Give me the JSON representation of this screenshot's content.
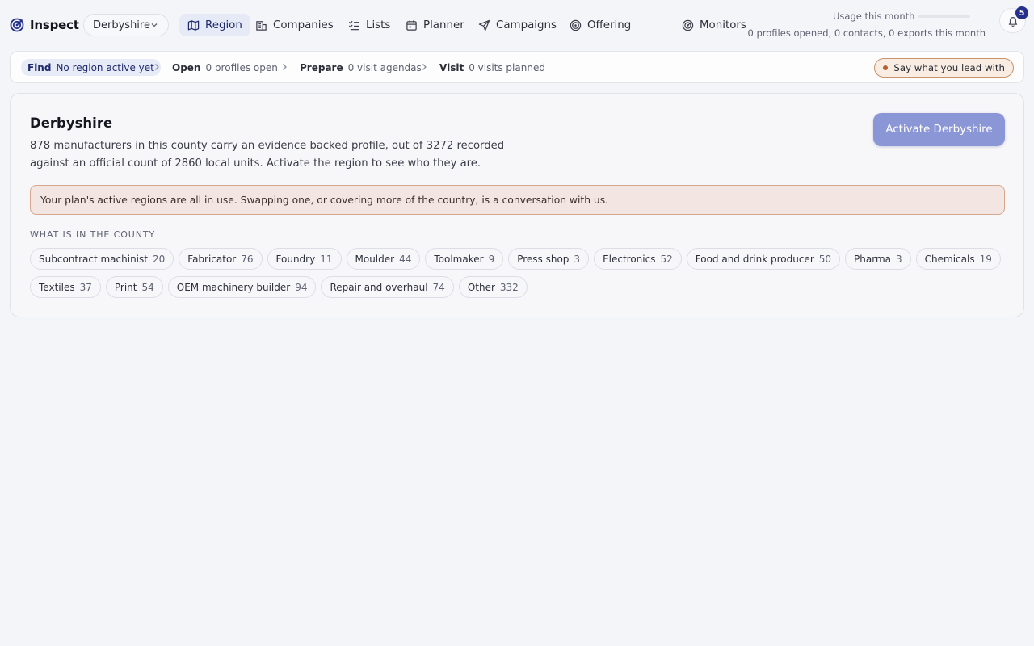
{
  "brand": {
    "name": "Inspect"
  },
  "region_select": {
    "value": "Derbyshire"
  },
  "nav": {
    "region": "Region",
    "companies": "Companies",
    "lists": "Lists",
    "planner": "Planner",
    "campaigns": "Campaigns",
    "offering": "Offering",
    "monitors": "Monitors"
  },
  "usage": {
    "label": "Usage this month",
    "progress": 0,
    "detail": "0 profiles opened, 0 contacts, 0 exports this month"
  },
  "notifications": {
    "count": "5"
  },
  "steps": {
    "find": {
      "name": "Find",
      "value": "No region active yet"
    },
    "open": {
      "name": "Open",
      "value": "0 profiles open"
    },
    "prepare": {
      "name": "Prepare",
      "value": "0 visit agendas"
    },
    "visit": {
      "name": "Visit",
      "value": "0 visits planned"
    },
    "lead_pill": "Say what you lead with"
  },
  "card": {
    "title": "Derbyshire",
    "description_line1": "878 manufacturers in this county carry an evidence backed profile, out of 3272 recorded",
    "description_line2": "against an official count of 2860 local units. Activate the region to see who they are.",
    "activate_label": "Activate Derbyshire",
    "notice": "Your plan's active regions are all in use. Swapping one, or covering more of the country, is a conversation with us.",
    "section_label": "WHAT IS IN THE COUNTY",
    "chips": [
      {
        "label": "Subcontract machinist",
        "count": "20"
      },
      {
        "label": "Fabricator",
        "count": "76"
      },
      {
        "label": "Foundry",
        "count": "11"
      },
      {
        "label": "Moulder",
        "count": "44"
      },
      {
        "label": "Toolmaker",
        "count": "9"
      },
      {
        "label": "Press shop",
        "count": "3"
      },
      {
        "label": "Electronics",
        "count": "52"
      },
      {
        "label": "Food and drink producer",
        "count": "50"
      },
      {
        "label": "Pharma",
        "count": "3"
      },
      {
        "label": "Chemicals",
        "count": "19"
      },
      {
        "label": "Textiles",
        "count": "37"
      },
      {
        "label": "Print",
        "count": "54"
      },
      {
        "label": "OEM machinery builder",
        "count": "94"
      },
      {
        "label": "Repair and overhaul",
        "count": "74"
      },
      {
        "label": "Other",
        "count": "332"
      }
    ]
  },
  "colors": {
    "accent": "#24308a",
    "active_nav_bg": "#e6eaf6",
    "activate_button": "#8b96d6",
    "notice_bg": "#f3e5e2",
    "notice_border": "#d7a78d",
    "lead_dot": "#b5612d"
  },
  "icons": {
    "brand": "target-logo-icon",
    "region": "map-icon",
    "companies": "building-icon",
    "lists": "checklist-icon",
    "planner": "calendar-icon",
    "campaigns": "send-icon",
    "offering": "target-icon",
    "monitors": "radar-icon",
    "notifications": "bell-icon"
  }
}
